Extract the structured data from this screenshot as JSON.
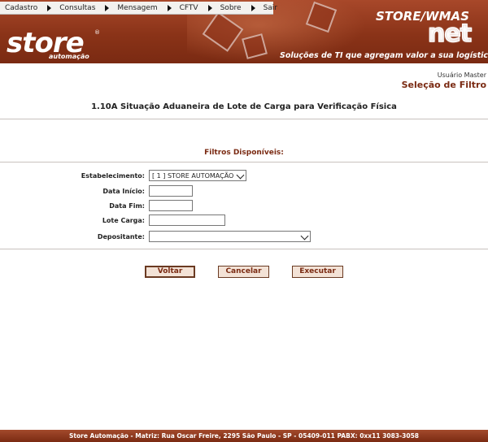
{
  "menu": {
    "items": [
      {
        "label": "Cadastro"
      },
      {
        "label": "Consultas"
      },
      {
        "label": "Mensagem"
      },
      {
        "label": "CFTV"
      },
      {
        "label": "Sobre"
      },
      {
        "label": "Sair"
      }
    ]
  },
  "banner": {
    "logo_text": "store",
    "logo_reg": "®",
    "logo_sub": "automação",
    "brand_line1": "STORE/WMAS",
    "brand_line2": "net",
    "slogan": "Soluções de TI que agregam valor a sua logística"
  },
  "header": {
    "user": "Usuário Master",
    "subtitle": "Seleção de Filtro"
  },
  "page": {
    "title": "1.10A Situação Aduaneira de Lote de Carga para Verificação Física"
  },
  "filters": {
    "heading": "Filtros Disponíveis:",
    "estabelecimento_label": "Estabelecimento:",
    "estabelecimento_value": "[ 1 ] STORE AUTOMAÇÃO",
    "data_inicio_label": "Data Início:",
    "data_inicio_value": "",
    "data_fim_label": "Data Fim:",
    "data_fim_value": "",
    "lote_carga_label": "Lote Carga:",
    "lote_carga_value": "",
    "depositante_label": "Depositante:",
    "depositante_value": ""
  },
  "buttons": {
    "voltar": "Voltar",
    "cancelar": "Cancelar",
    "executar": "Executar"
  },
  "footer": {
    "text": "Store Automação - Matriz: Rua Oscar Freire, 2295 São Paulo - SP - 05409-011 PABX: 0xx11 3083-3058"
  },
  "colors": {
    "brand": "#8a3318",
    "accent_text": "#7a2a12",
    "button_bg": "#f3e2d6"
  }
}
